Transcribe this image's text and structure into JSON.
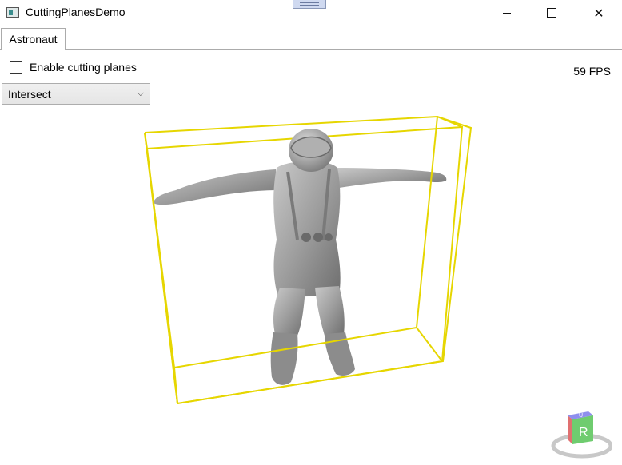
{
  "window": {
    "title": "CuttingPlanesDemo",
    "minimize_label": "—",
    "maximize_label": "☐",
    "close_label": "✕"
  },
  "tabs": [
    {
      "label": "Astronaut",
      "selected": true
    }
  ],
  "controls": {
    "cutting_planes_label": "Enable cutting planes",
    "cutting_planes_checked": false,
    "operation": {
      "selected": "Intersect"
    },
    "fps_text": "59 FPS"
  },
  "viewport": {
    "bounding_box_color": "#e6d600",
    "model_color": "#9a9a9a",
    "viewcube": {
      "face_label": "R",
      "top_label": "U"
    }
  }
}
